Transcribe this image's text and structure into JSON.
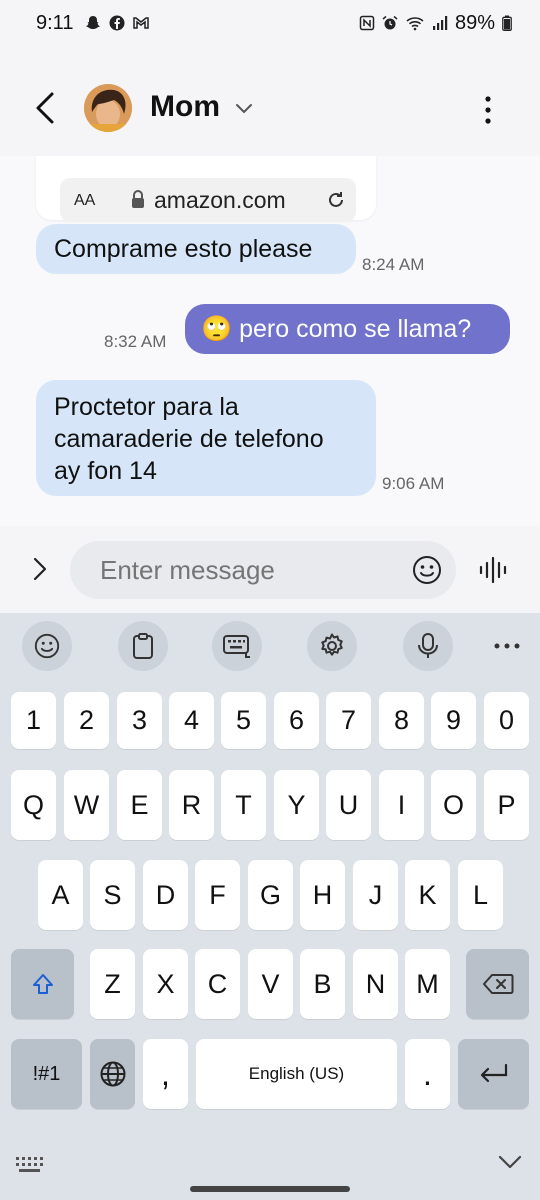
{
  "status_bar": {
    "time": "9:11",
    "battery": "89%"
  },
  "header": {
    "contact_name": "Mom"
  },
  "preview": {
    "text_size_label": "AA",
    "url": "amazon.com"
  },
  "messages": [
    {
      "direction": "in",
      "text": "Comprame esto please",
      "time": "8:24 AM"
    },
    {
      "direction": "out",
      "emoji": "🙄",
      "text": "pero como se llama?",
      "time": "8:32 AM"
    },
    {
      "direction": "in",
      "lines": [
        "Proctetor para la",
        "camaraderie de telefono",
        "ay fon 14"
      ],
      "time": "9:06 AM"
    }
  ],
  "composer": {
    "placeholder": "Enter message"
  },
  "keyboard": {
    "number_row": [
      "1",
      "2",
      "3",
      "4",
      "5",
      "6",
      "7",
      "8",
      "9",
      "0"
    ],
    "row1": [
      "Q",
      "W",
      "E",
      "R",
      "T",
      "Y",
      "U",
      "I",
      "O",
      "P"
    ],
    "row2": [
      "A",
      "S",
      "D",
      "F",
      "G",
      "H",
      "J",
      "K",
      "L"
    ],
    "row3": [
      "Z",
      "X",
      "C",
      "V",
      "B",
      "N",
      "M"
    ],
    "symbols_label": "!#1",
    "comma": ",",
    "space_label": "English (US)",
    "period": "."
  },
  "colors": {
    "incoming_bubble": "#d6e6f8",
    "outgoing_bubble": "#7072cc",
    "keyboard_bg": "#dde2e8"
  }
}
